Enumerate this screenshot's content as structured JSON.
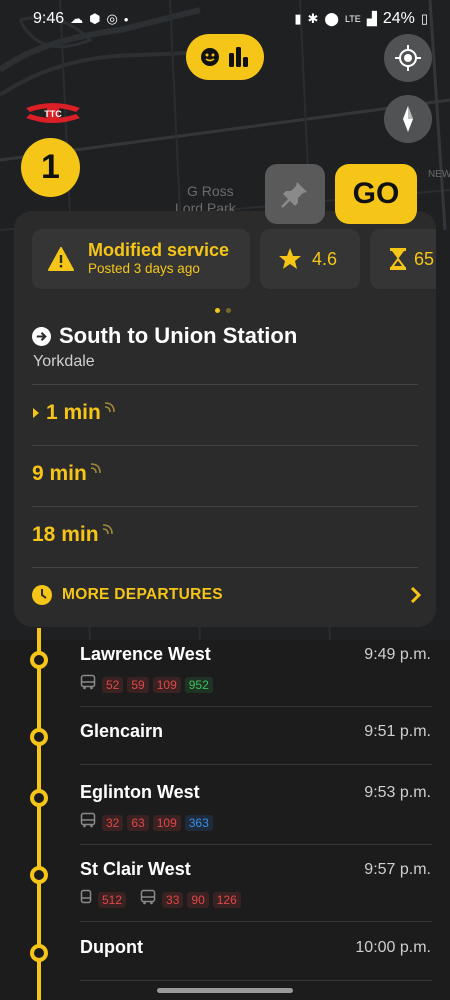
{
  "status_bar": {
    "time": "9:46",
    "battery": "24%",
    "network": "LTE",
    "icons": [
      "cloud-icon",
      "app-icon",
      "whatsapp-icon",
      "dot-icon",
      "battery-saver-icon",
      "bluetooth-icon",
      "location-icon",
      "signal-icon",
      "battery-icon"
    ]
  },
  "map": {
    "labels": [
      "G Ross",
      "Lord Park",
      "NEW"
    ]
  },
  "top_controls": {
    "feedback_icons": [
      "smiley-icon",
      "bar-chart-icon"
    ],
    "locate_icon": "crosshair-icon",
    "compass_icon": "compass-icon"
  },
  "line": {
    "number": "1",
    "color": "#f5c518",
    "agency_logo": "TTC"
  },
  "actions": {
    "pin_icon": "pin-icon",
    "go_label": "GO"
  },
  "card": {
    "alert": {
      "title": "Modified service",
      "subtitle": "Posted 3 days ago",
      "icon": "warning-icon"
    },
    "rating": {
      "value": "4.6",
      "icon": "star-icon"
    },
    "wait": {
      "value": "65",
      "icon": "hourglass-icon"
    },
    "direction": "South to Union Station",
    "station": "Yorkdale",
    "departures": [
      {
        "time": "1 min",
        "realtime": true
      },
      {
        "time": "9 min",
        "realtime": true
      },
      {
        "time": "18 min",
        "realtime": true
      }
    ],
    "more_label": "MORE DEPARTURES"
  },
  "stops": [
    {
      "name": "Lawrence West",
      "time": "9:49 p.m.",
      "connections": [
        {
          "mode": "bus",
          "routes": [
            {
              "n": "52",
              "c": "red"
            },
            {
              "n": "59",
              "c": "red"
            },
            {
              "n": "109",
              "c": "red"
            },
            {
              "n": "952",
              "c": "green"
            }
          ]
        }
      ]
    },
    {
      "name": "Glencairn",
      "time": "9:51 p.m.",
      "connections": []
    },
    {
      "name": "Eglinton West",
      "time": "9:53 p.m.",
      "connections": [
        {
          "mode": "bus",
          "routes": [
            {
              "n": "32",
              "c": "red"
            },
            {
              "n": "63",
              "c": "red"
            },
            {
              "n": "109",
              "c": "red"
            },
            {
              "n": "363",
              "c": "blue"
            }
          ]
        }
      ]
    },
    {
      "name": "St Clair West",
      "time": "9:57 p.m.",
      "connections": [
        {
          "mode": "tram",
          "routes": [
            {
              "n": "512",
              "c": "red"
            }
          ]
        },
        {
          "mode": "bus",
          "routes": [
            {
              "n": "33",
              "c": "red"
            },
            {
              "n": "90",
              "c": "red"
            },
            {
              "n": "126",
              "c": "red"
            }
          ]
        }
      ]
    },
    {
      "name": "Dupont",
      "time": "10:00 p.m.",
      "connections": []
    }
  ]
}
